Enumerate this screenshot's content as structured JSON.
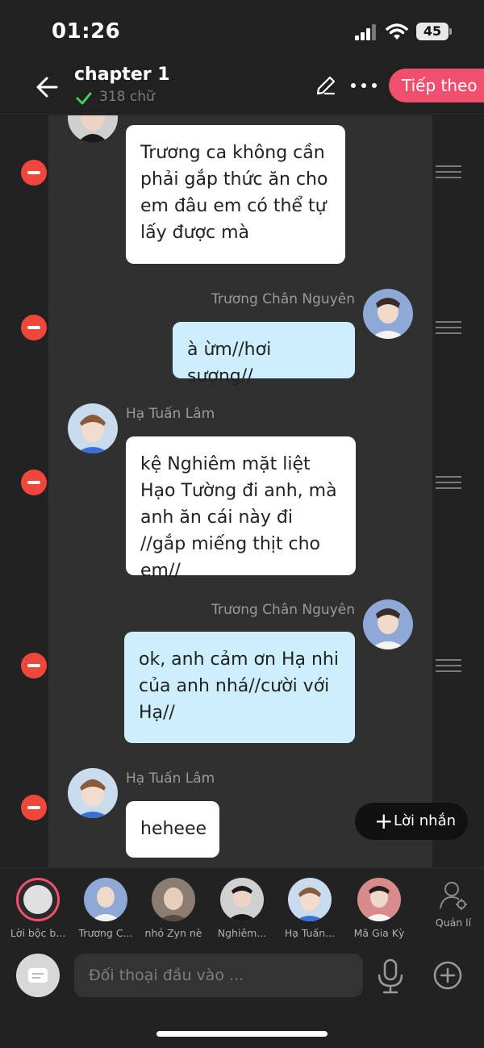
{
  "status_bar": {
    "time": "01:26",
    "battery": "45"
  },
  "header": {
    "title": "chapter 1",
    "word_count": "318 chữ",
    "next_label": "Tiếp theo",
    "icons": [
      "back-arrow-icon",
      "check-icon",
      "pencil-icon",
      "more-icon"
    ]
  },
  "messages": [
    {
      "side": "left",
      "speaker": "",
      "text": "Trương ca không cần phải gắp thức ăn cho em đâu em có thể tự lấy được mà"
    },
    {
      "side": "right",
      "speaker": "Trương Chân Nguyên",
      "text": "à ừm//hơi sượng//"
    },
    {
      "side": "left",
      "speaker": "Hạ Tuấn Lâm",
      "text": "kệ Nghiêm mặt liệt Hạo Tường đi anh, mà anh ăn cái này đi //gắp miếng thịt cho em//"
    },
    {
      "side": "right",
      "speaker": "Trương Chân Nguyên",
      "text": "ok, anh cảm ơn Hạ nhi của anh nhá//cười với Hạ//"
    },
    {
      "side": "left",
      "speaker": "Hạ Tuấn Lâm",
      "text": "heheee"
    }
  ],
  "add_note_label": "Lời nhắn",
  "characters": [
    {
      "label": "Lời bộc b..."
    },
    {
      "label": "Trương C..."
    },
    {
      "label": "nhỏ Zyn nè"
    },
    {
      "label": "Nghiêm..."
    },
    {
      "label": "Hạ Tuấn..."
    },
    {
      "label": "Mã Gia Kỳ"
    }
  ],
  "manage_label": "Quản lí",
  "input": {
    "placeholder": "Đối thoại đầu vào ..."
  },
  "colors": {
    "accent": "#f0506e",
    "remove": "#f0473d",
    "bubble_right": "#cdeffd",
    "bubble_left": "#ffffff"
  }
}
